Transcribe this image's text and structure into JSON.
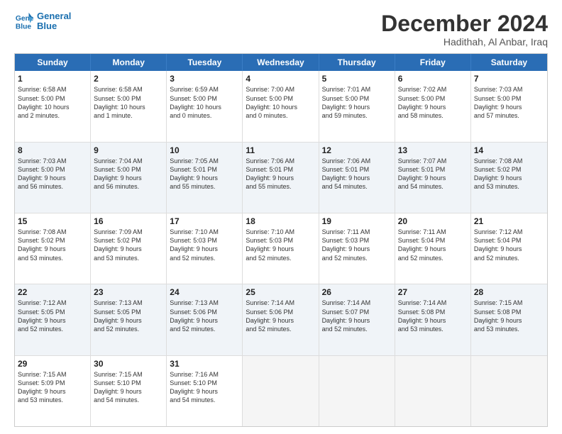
{
  "header": {
    "logo_line1": "General",
    "logo_line2": "Blue",
    "month_title": "December 2024",
    "location": "Hadithah, Al Anbar, Iraq"
  },
  "days_of_week": [
    "Sunday",
    "Monday",
    "Tuesday",
    "Wednesday",
    "Thursday",
    "Friday",
    "Saturday"
  ],
  "rows": [
    [
      {
        "day": "1",
        "lines": [
          "Sunrise: 6:58 AM",
          "Sunset: 5:00 PM",
          "Daylight: 10 hours",
          "and 2 minutes."
        ]
      },
      {
        "day": "2",
        "lines": [
          "Sunrise: 6:58 AM",
          "Sunset: 5:00 PM",
          "Daylight: 10 hours",
          "and 1 minute."
        ]
      },
      {
        "day": "3",
        "lines": [
          "Sunrise: 6:59 AM",
          "Sunset: 5:00 PM",
          "Daylight: 10 hours",
          "and 0 minutes."
        ]
      },
      {
        "day": "4",
        "lines": [
          "Sunrise: 7:00 AM",
          "Sunset: 5:00 PM",
          "Daylight: 10 hours",
          "and 0 minutes."
        ]
      },
      {
        "day": "5",
        "lines": [
          "Sunrise: 7:01 AM",
          "Sunset: 5:00 PM",
          "Daylight: 9 hours",
          "and 59 minutes."
        ]
      },
      {
        "day": "6",
        "lines": [
          "Sunrise: 7:02 AM",
          "Sunset: 5:00 PM",
          "Daylight: 9 hours",
          "and 58 minutes."
        ]
      },
      {
        "day": "7",
        "lines": [
          "Sunrise: 7:03 AM",
          "Sunset: 5:00 PM",
          "Daylight: 9 hours",
          "and 57 minutes."
        ]
      }
    ],
    [
      {
        "day": "8",
        "lines": [
          "Sunrise: 7:03 AM",
          "Sunset: 5:00 PM",
          "Daylight: 9 hours",
          "and 56 minutes."
        ]
      },
      {
        "day": "9",
        "lines": [
          "Sunrise: 7:04 AM",
          "Sunset: 5:00 PM",
          "Daylight: 9 hours",
          "and 56 minutes."
        ]
      },
      {
        "day": "10",
        "lines": [
          "Sunrise: 7:05 AM",
          "Sunset: 5:01 PM",
          "Daylight: 9 hours",
          "and 55 minutes."
        ]
      },
      {
        "day": "11",
        "lines": [
          "Sunrise: 7:06 AM",
          "Sunset: 5:01 PM",
          "Daylight: 9 hours",
          "and 55 minutes."
        ]
      },
      {
        "day": "12",
        "lines": [
          "Sunrise: 7:06 AM",
          "Sunset: 5:01 PM",
          "Daylight: 9 hours",
          "and 54 minutes."
        ]
      },
      {
        "day": "13",
        "lines": [
          "Sunrise: 7:07 AM",
          "Sunset: 5:01 PM",
          "Daylight: 9 hours",
          "and 54 minutes."
        ]
      },
      {
        "day": "14",
        "lines": [
          "Sunrise: 7:08 AM",
          "Sunset: 5:02 PM",
          "Daylight: 9 hours",
          "and 53 minutes."
        ]
      }
    ],
    [
      {
        "day": "15",
        "lines": [
          "Sunrise: 7:08 AM",
          "Sunset: 5:02 PM",
          "Daylight: 9 hours",
          "and 53 minutes."
        ]
      },
      {
        "day": "16",
        "lines": [
          "Sunrise: 7:09 AM",
          "Sunset: 5:02 PM",
          "Daylight: 9 hours",
          "and 53 minutes."
        ]
      },
      {
        "day": "17",
        "lines": [
          "Sunrise: 7:10 AM",
          "Sunset: 5:03 PM",
          "Daylight: 9 hours",
          "and 52 minutes."
        ]
      },
      {
        "day": "18",
        "lines": [
          "Sunrise: 7:10 AM",
          "Sunset: 5:03 PM",
          "Daylight: 9 hours",
          "and 52 minutes."
        ]
      },
      {
        "day": "19",
        "lines": [
          "Sunrise: 7:11 AM",
          "Sunset: 5:03 PM",
          "Daylight: 9 hours",
          "and 52 minutes."
        ]
      },
      {
        "day": "20",
        "lines": [
          "Sunrise: 7:11 AM",
          "Sunset: 5:04 PM",
          "Daylight: 9 hours",
          "and 52 minutes."
        ]
      },
      {
        "day": "21",
        "lines": [
          "Sunrise: 7:12 AM",
          "Sunset: 5:04 PM",
          "Daylight: 9 hours",
          "and 52 minutes."
        ]
      }
    ],
    [
      {
        "day": "22",
        "lines": [
          "Sunrise: 7:12 AM",
          "Sunset: 5:05 PM",
          "Daylight: 9 hours",
          "and 52 minutes."
        ]
      },
      {
        "day": "23",
        "lines": [
          "Sunrise: 7:13 AM",
          "Sunset: 5:05 PM",
          "Daylight: 9 hours",
          "and 52 minutes."
        ]
      },
      {
        "day": "24",
        "lines": [
          "Sunrise: 7:13 AM",
          "Sunset: 5:06 PM",
          "Daylight: 9 hours",
          "and 52 minutes."
        ]
      },
      {
        "day": "25",
        "lines": [
          "Sunrise: 7:14 AM",
          "Sunset: 5:06 PM",
          "Daylight: 9 hours",
          "and 52 minutes."
        ]
      },
      {
        "day": "26",
        "lines": [
          "Sunrise: 7:14 AM",
          "Sunset: 5:07 PM",
          "Daylight: 9 hours",
          "and 52 minutes."
        ]
      },
      {
        "day": "27",
        "lines": [
          "Sunrise: 7:14 AM",
          "Sunset: 5:08 PM",
          "Daylight: 9 hours",
          "and 53 minutes."
        ]
      },
      {
        "day": "28",
        "lines": [
          "Sunrise: 7:15 AM",
          "Sunset: 5:08 PM",
          "Daylight: 9 hours",
          "and 53 minutes."
        ]
      }
    ],
    [
      {
        "day": "29",
        "lines": [
          "Sunrise: 7:15 AM",
          "Sunset: 5:09 PM",
          "Daylight: 9 hours",
          "and 53 minutes."
        ]
      },
      {
        "day": "30",
        "lines": [
          "Sunrise: 7:15 AM",
          "Sunset: 5:10 PM",
          "Daylight: 9 hours",
          "and 54 minutes."
        ]
      },
      {
        "day": "31",
        "lines": [
          "Sunrise: 7:16 AM",
          "Sunset: 5:10 PM",
          "Daylight: 9 hours",
          "and 54 minutes."
        ]
      },
      {
        "day": "",
        "lines": []
      },
      {
        "day": "",
        "lines": []
      },
      {
        "day": "",
        "lines": []
      },
      {
        "day": "",
        "lines": []
      }
    ]
  ]
}
